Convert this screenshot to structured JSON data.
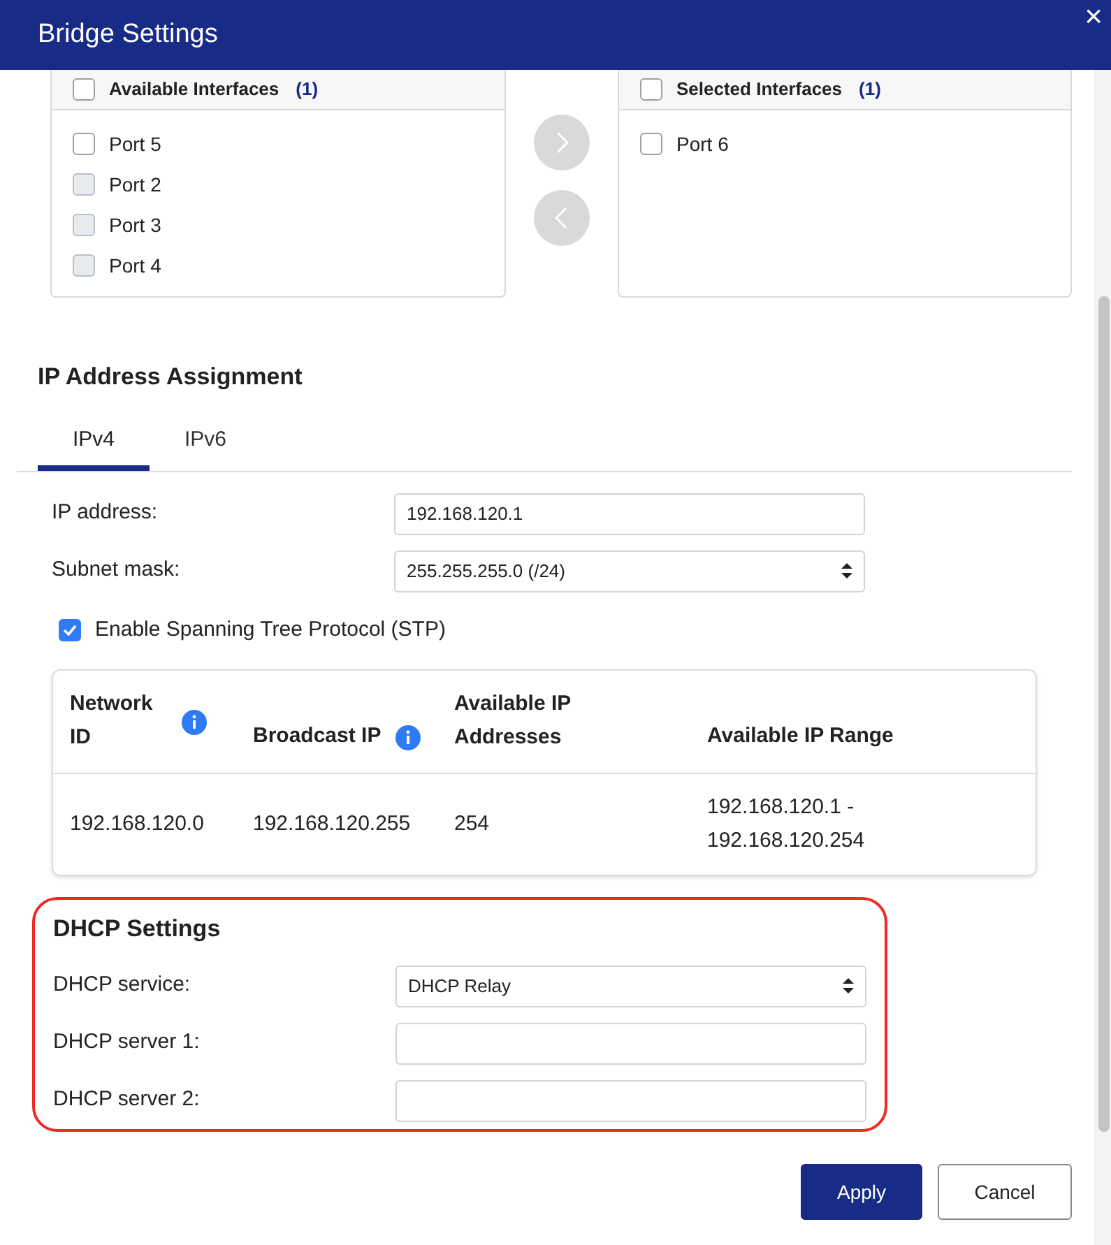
{
  "dialog": {
    "title": "Bridge Settings",
    "close": "×"
  },
  "interfaces": {
    "available": {
      "label": "Available Interfaces",
      "count": "(1)",
      "checked": false,
      "items": [
        {
          "label": "Port 5",
          "checked": false,
          "disabled": false
        },
        {
          "label": "Port 2",
          "checked": false,
          "disabled": true
        },
        {
          "label": "Port 3",
          "checked": false,
          "disabled": true
        },
        {
          "label": "Port 4",
          "checked": false,
          "disabled": true
        }
      ]
    },
    "selected": {
      "label": "Selected Interfaces",
      "count": "(1)",
      "checked": false,
      "items": [
        {
          "label": "Port 6",
          "checked": false,
          "disabled": false
        }
      ]
    }
  },
  "ip_assignment": {
    "title": "IP Address Assignment",
    "tabs": [
      {
        "label": "IPv4",
        "selected": true
      },
      {
        "label": "IPv6",
        "selected": false
      }
    ],
    "fields": [
      {
        "kind": "text",
        "label": "IP address:",
        "value": "192.168.120.1"
      },
      {
        "kind": "select",
        "label": "Subnet mask:",
        "value": "255.255.255.0 (/24)"
      }
    ],
    "stp": {
      "label": "Enable Spanning Tree Protocol (STP)",
      "checked": true
    },
    "table": {
      "columns": [
        {
          "label": "Network ID",
          "kind": "info"
        },
        {
          "label": "Broadcast IP",
          "kind": "info"
        },
        {
          "label": "Available IP Addresses",
          "kind": "plain"
        },
        {
          "label": "Available IP Range",
          "kind": "plain"
        }
      ],
      "rows": [
        [
          "192.168.120.0",
          "192.168.120.255",
          "254",
          "192.168.120.1 - 192.168.120.254"
        ]
      ]
    }
  },
  "dhcp": {
    "title": "DHCP Settings",
    "fields": [
      {
        "kind": "select",
        "label": "DHCP service:",
        "value": "DHCP Relay"
      },
      {
        "kind": "text",
        "label": "DHCP server 1:"
      },
      {
        "kind": "text",
        "label": "DHCP server 2:"
      }
    ]
  },
  "buttons": [
    {
      "label": "Apply",
      "kind": "primary"
    },
    {
      "label": "Cancel",
      "kind": "secondary"
    }
  ]
}
